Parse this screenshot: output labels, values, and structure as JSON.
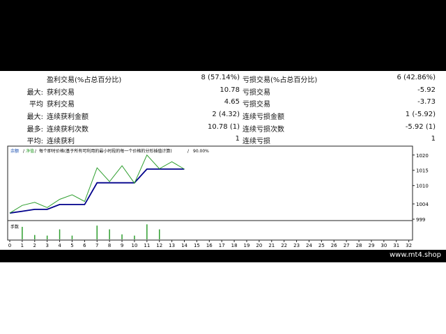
{
  "stats": {
    "rows": [
      {
        "prefix": "",
        "label1": "盈利交易(%占总百分比)",
        "val1": "8 (57.14%)",
        "label2": "亏损交易(%占总百分比)",
        "val2": "6 (42.86%)"
      },
      {
        "prefix": "最大:",
        "label1": "获利交易",
        "val1": "10.78",
        "label2": "亏损交易",
        "val2": "-5.92"
      },
      {
        "prefix": "平均",
        "label1": "获利交易",
        "val1": "4.65",
        "label2": "亏损交易",
        "val2": "-3.73"
      },
      {
        "prefix": "最大:",
        "label1": "连续获利金额",
        "val1": "2 (4.32)",
        "label2": "连续亏损金额",
        "val2": "1 (-5.92)"
      },
      {
        "prefix": "最多:",
        "label1": "连续获利次数",
        "val1": "10.78 (1)",
        "label2": "连续亏损次数",
        "val2": "-5.92 (1)"
      },
      {
        "prefix": "平均:",
        "label1": "连续获利",
        "val1": "1",
        "label2": "连续亏损",
        "val2": "1"
      }
    ]
  },
  "chart": {
    "legend": {
      "balance": "余额",
      "sep1": " / ",
      "equity": "净值",
      "sep2": " / ",
      "desc": "每个即时价格(基于所有可利用的最小时段的每一个价格的分形插值计算)",
      "sep3": " / ",
      "quality": "90.00%"
    },
    "volume_label": "手数",
    "colors": {
      "balance": "#00008b",
      "equity": "#2e9e2e",
      "volume": "#2e9e2e"
    }
  },
  "chart_data": {
    "type": "line",
    "x_ticks": [
      0,
      1,
      2,
      3,
      4,
      5,
      6,
      7,
      8,
      9,
      10,
      11,
      12,
      13,
      14,
      15,
      16,
      17,
      18,
      19,
      20,
      21,
      22,
      23,
      24,
      25,
      26,
      27,
      28,
      29,
      30,
      31,
      32
    ],
    "y_ticks": [
      1020,
      1015,
      1010,
      1004,
      999
    ],
    "ylim": [
      999,
      1022
    ],
    "xlim": [
      0,
      32.3
    ],
    "series": [
      {
        "name": "余额",
        "x": [
          0,
          1,
          2,
          3,
          4,
          5,
          6,
          7,
          8,
          9,
          10,
          11,
          12,
          13,
          14
        ],
        "values": [
          1001,
          1003.5,
          1004.5,
          1002.8,
          1005.5,
          1007,
          1004.8,
          1015.8,
          1011.3,
          1016.5,
          1010.8,
          1020,
          1015.5,
          1017.8,
          1015.4
        ]
      },
      {
        "name": "净值",
        "x": [
          0,
          1,
          2,
          3,
          4,
          5,
          6,
          7,
          8,
          9,
          10,
          11,
          12,
          13,
          14
        ],
        "values": [
          1001,
          1001.6,
          1002.2,
          1002.2,
          1003.8,
          1003.8,
          1003.8,
          1010.9,
          1010.9,
          1010.9,
          1010.9,
          1015.4,
          1015.4,
          1015.4,
          1015.4
        ]
      }
    ],
    "volume": {
      "x": [
        1,
        2,
        3,
        4,
        5,
        7,
        8,
        9,
        10,
        11,
        12
      ],
      "values": [
        1,
        0.35,
        0.3,
        0.8,
        0.3,
        1.1,
        0.8,
        0.4,
        0.3,
        1.2,
        0.8
      ]
    }
  }
}
